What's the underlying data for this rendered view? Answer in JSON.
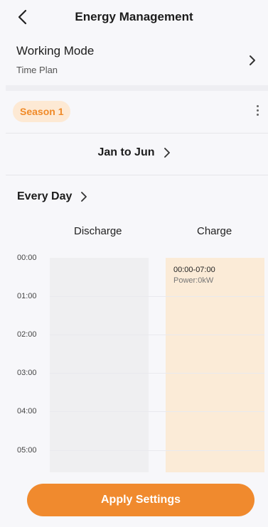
{
  "header": {
    "title": "Energy Management",
    "back_icon": "chevron-left-icon"
  },
  "working_mode": {
    "label": "Working Mode",
    "value": "Time Plan"
  },
  "season": {
    "label": "Season 1",
    "more_icon": "more-vertical-icon"
  },
  "months": {
    "label": "Jan to Jun"
  },
  "days": {
    "label": "Every Day"
  },
  "columns": {
    "discharge": "Discharge",
    "charge": "Charge"
  },
  "times": [
    "00:00",
    "01:00",
    "02:00",
    "03:00",
    "04:00",
    "05:00"
  ],
  "charge_block": {
    "time": "00:00-07:00",
    "power": "Power:0kW"
  },
  "actions": {
    "apply": "Apply Settings"
  },
  "colors": {
    "accent": "#f08a2e",
    "accent_soft": "#fde9d4",
    "charge_fill": "#fbebd7",
    "discharge_fill": "#efeff1"
  }
}
